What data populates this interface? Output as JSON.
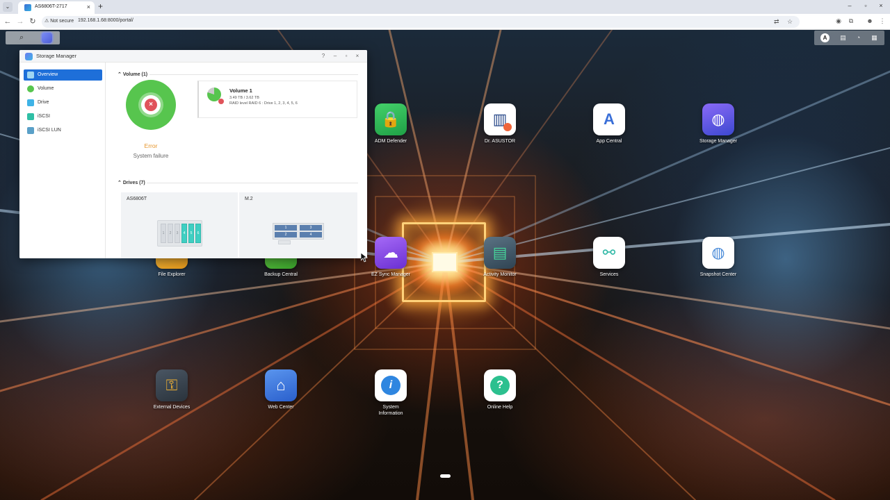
{
  "browser": {
    "tab_title": "AS6806T-2717",
    "tab_close": "×",
    "new_tab": "+",
    "tab_menu": "⌄",
    "window_controls": [
      "–",
      "▫",
      "×"
    ],
    "security_label": "Not secure",
    "url": "192.168.1.68:8000/portal/",
    "nav": {
      "back": "←",
      "forward": "→",
      "reload": "↻"
    }
  },
  "desktop": {
    "search_icon": "magnifier",
    "top_right_user_initial": "A",
    "apps": [
      {
        "label": "ADM Defender",
        "icon": "lock-shield-icon",
        "color": "#3bbd5a"
      },
      {
        "label": "Dr. ASUSTOR",
        "icon": "clinic-icon",
        "color": "#ffffff"
      },
      {
        "label": "App Central",
        "icon": "app-store-icon",
        "color": "#ffffff"
      },
      {
        "label": "Storage Manager",
        "icon": "database-icon",
        "color": "#6a5cf0"
      },
      {
        "label": "File Explorer",
        "icon": "folder-icon",
        "color": "#f2b233"
      },
      {
        "label": "Backup Central",
        "icon": "backup-icon",
        "color": "#5cc63d"
      },
      {
        "label": "EZ Sync Manager",
        "icon": "cloud-sync-icon",
        "color": "#8c4de8"
      },
      {
        "label": "Activity Monitor",
        "icon": "monitor-icon",
        "color": "#4a6070"
      },
      {
        "label": "Services",
        "icon": "nodes-icon",
        "color": "#ffffff"
      },
      {
        "label": "Snapshot Center",
        "icon": "snapshot-icon",
        "color": "#ffffff"
      },
      {
        "label": "External Devices",
        "icon": "usb-icon",
        "color": "#3a4550"
      },
      {
        "label": "Web Center",
        "icon": "web-icon",
        "color": "#3f7ee0"
      },
      {
        "label": "System Information",
        "icon": "info-icon",
        "color": "#ffffff"
      },
      {
        "label": "Online Help",
        "icon": "help-icon",
        "color": "#ffffff"
      }
    ]
  },
  "storage_manager": {
    "title": "Storage Manager",
    "controls": {
      "help": "?",
      "minimize": "–",
      "maximize": "▫",
      "close": "×"
    },
    "nav": [
      {
        "label": "Overview",
        "active": true,
        "icon": "overview-icon",
        "color": "#3fb3e6"
      },
      {
        "label": "Volume",
        "active": false,
        "icon": "volume-icon",
        "color": "#57c54e"
      },
      {
        "label": "Drive",
        "active": false,
        "icon": "drive-icon",
        "color": "#3fb3e6"
      },
      {
        "label": "iSCSI",
        "active": false,
        "icon": "iscsi-icon",
        "color": "#2fbfa5"
      },
      {
        "label": "iSCSI LUN",
        "active": false,
        "icon": "iscsi-lun-icon",
        "color": "#5aa0c8"
      }
    ],
    "volume_section": {
      "heading": "Volume (1)",
      "status": "Error",
      "status_detail": "System failure",
      "volume": {
        "name": "Volume 1",
        "usage": "3.49 TB / 3.62 TB",
        "raid": "RAID level RAID 6 : Drive 1, 2, 3, 4, 5, 6"
      }
    },
    "drives_section": {
      "heading": "Drives (7)",
      "panels": [
        {
          "title": "AS6806T",
          "bays": [
            "1",
            "2",
            "3",
            "4",
            "5",
            "6"
          ],
          "active_bays": [
            4,
            5,
            6
          ]
        },
        {
          "title": "M.2",
          "slots": [
            "1",
            "3",
            "2",
            "4"
          ]
        }
      ]
    }
  }
}
